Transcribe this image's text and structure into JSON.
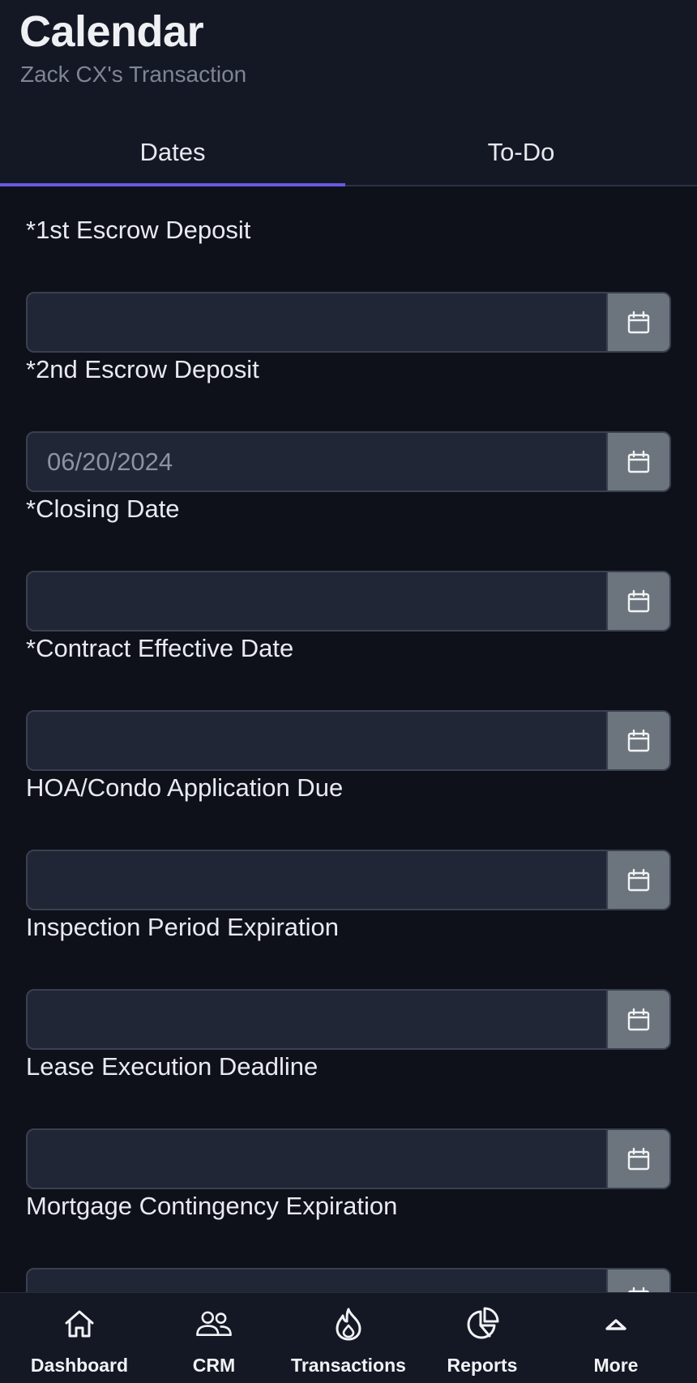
{
  "header": {
    "title": "Calendar",
    "subtitle": "Zack CX's Transaction"
  },
  "tabs": [
    {
      "label": "Dates",
      "active": true
    },
    {
      "label": "To-Do",
      "active": false
    }
  ],
  "fields": [
    {
      "label": "*1st Escrow Deposit",
      "value": "",
      "placeholder": ""
    },
    {
      "label": "*2nd Escrow Deposit",
      "value": "",
      "placeholder": "06/20/2024"
    },
    {
      "label": "*Closing Date",
      "value": "",
      "placeholder": ""
    },
    {
      "label": "*Contract Effective Date",
      "value": "",
      "placeholder": ""
    },
    {
      "label": "HOA/Condo Application Due",
      "value": "",
      "placeholder": ""
    },
    {
      "label": "Inspection Period Expiration",
      "value": "",
      "placeholder": ""
    },
    {
      "label": "Lease Execution Deadline",
      "value": "",
      "placeholder": ""
    },
    {
      "label": "Mortgage Contingency Expiration",
      "value": "",
      "placeholder": ""
    }
  ],
  "field_icon": "calendar-icon",
  "bottom_nav": [
    {
      "label": "Dashboard",
      "icon": "home-icon",
      "active": false
    },
    {
      "label": "CRM",
      "icon": "users-icon",
      "active": false
    },
    {
      "label": "Transactions",
      "icon": "flame-icon",
      "active": true
    },
    {
      "label": "Reports",
      "icon": "pie-chart-icon",
      "active": false
    },
    {
      "label": "More",
      "icon": "chevron-up-icon",
      "active": false
    }
  ],
  "colors": {
    "background": "#0e111a",
    "surface": "#141824",
    "input_bg": "#212636",
    "tab_indicator": "#6a5ae0",
    "calendar_button": "#6c757d"
  }
}
